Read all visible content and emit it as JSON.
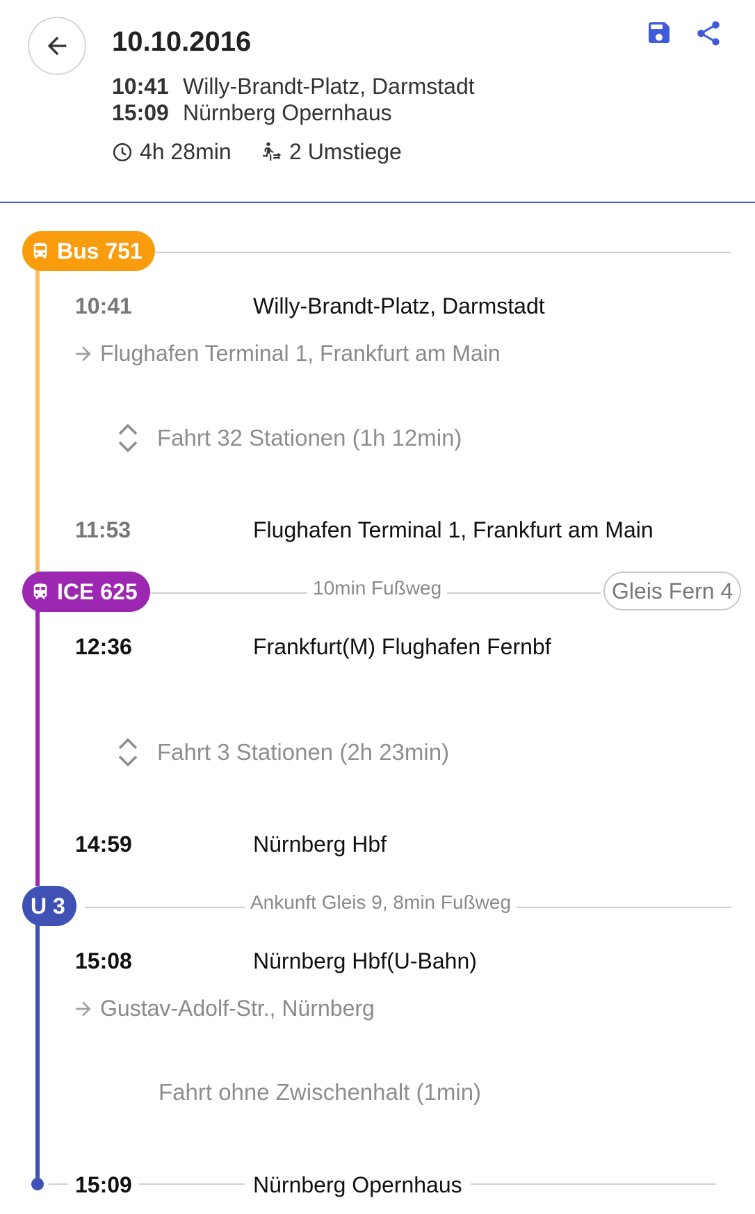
{
  "header": {
    "date": "10.10.2016",
    "departure": {
      "time": "10:41",
      "station": "Willy-Brandt-Platz, Darmstadt"
    },
    "arrival": {
      "time": "15:09",
      "station": "Nürnberg Opernhaus"
    },
    "duration": "4h 28min",
    "transfers": "2 Umstiege",
    "icons": {
      "back": "arrow-left-icon",
      "save": "save-icon",
      "share": "share-icon",
      "clock": "clock-icon",
      "transfer": "walking-transfer-icon"
    }
  },
  "colors": {
    "bus": "#f99d0f",
    "bus_line": "#f9bf63",
    "ice": "#9c27b0",
    "ubahn": "#3f51b5",
    "accent": "#3f5bd9"
  },
  "legs": [
    {
      "badge": "Bus 751",
      "icon": "bus-icon",
      "from_time": "10:41",
      "from_stop": "Willy-Brandt-Platz, Darmstadt",
      "direction": "Flughafen Terminal 1, Frankfurt am Main",
      "ride": "Fahrt 32 Stationen (1h 12min)",
      "to_time": "11:53",
      "to_stop": "Flughafen Terminal 1, Frankfurt am Main"
    },
    {
      "badge": "ICE 625",
      "icon": "train-icon",
      "walk": "10min Fußweg",
      "platform": "Gleis Fern 4",
      "from_time": "12:36",
      "from_stop": "Frankfurt(M) Flughafen Fernbf",
      "ride": "Fahrt 3 Stationen (2h 23min)",
      "to_time": "14:59",
      "to_stop": "Nürnberg Hbf"
    },
    {
      "badge": "U 3",
      "walk": "Ankunft Gleis 9, 8min Fußweg",
      "from_time": "15:08",
      "from_stop": "Nürnberg Hbf(U-Bahn)",
      "direction": "Gustav-Adolf-Str., Nürnberg",
      "ride": "Fahrt ohne Zwischenhalt (1min)",
      "to_time": "15:09",
      "to_stop": "Nürnberg Opernhaus"
    }
  ]
}
